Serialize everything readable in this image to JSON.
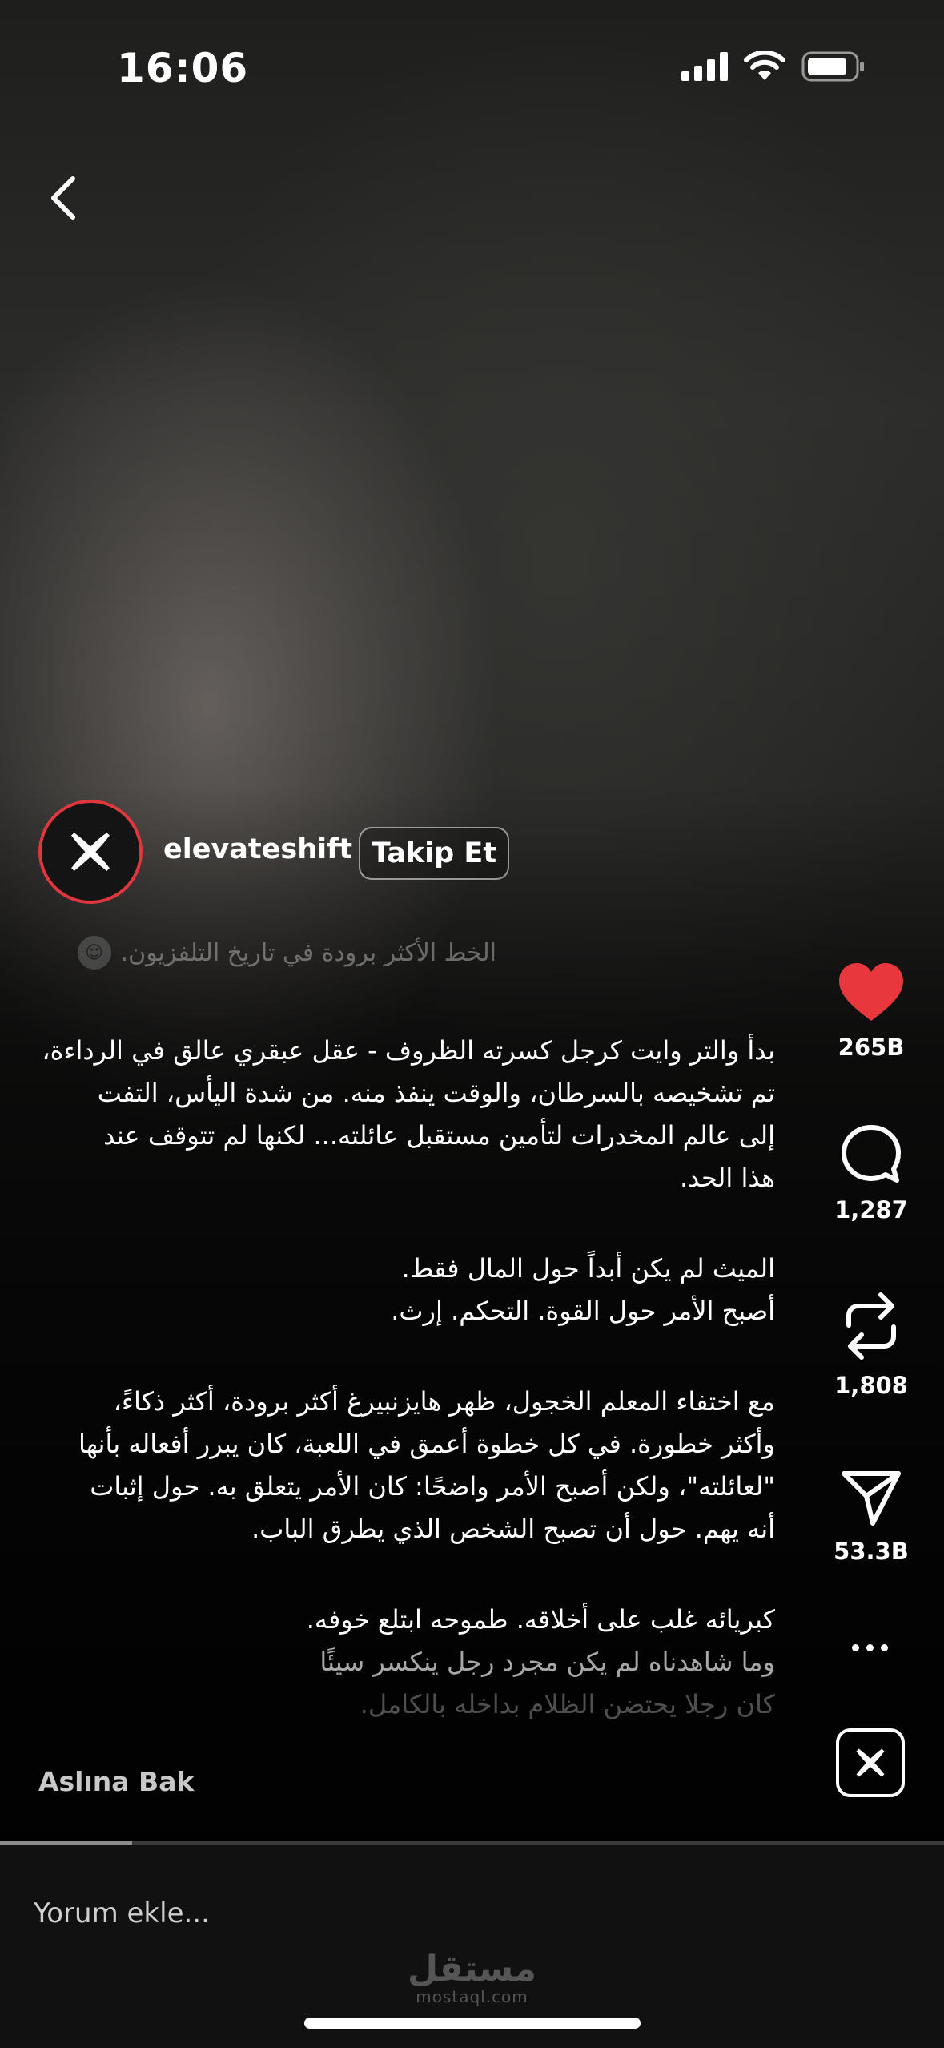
{
  "status_bar": {
    "time": "16:06"
  },
  "profile": {
    "username": "elevateshift",
    "follow_label": "Takip Et"
  },
  "caption": {
    "title": "الخط الأكثر برودة في تاريخ التلفزيون.",
    "paragraphs": [
      [
        "بدأ والتر وايت كرجل كسرته الظروف - عقل عبقري عالق في الرداءة،",
        "تم تشخيصه بالسرطان، والوقت ينفذ منه. من شدة اليأس، التفت",
        "إلى عالم المخدرات لتأمين مستقبل عائلته... لكنها لم تتوقف عند",
        "هذا الحد."
      ],
      [
        "الميث لم يكن أبداً حول المال فقط.",
        "أصبح الأمر حول القوة. التحكم. إرث."
      ],
      [
        "مع اختفاء المعلم الخجول، ظهر هايزنبيرغ أكثر برودة، أكثر ذكاءً،",
        "وأكثر خطورة. في كل خطوة أعمق في اللعبة، كان يبرر أفعاله بأنها",
        "\"لعائلته\"، ولكن أصبح الأمر واضحًا: كان الأمر يتعلق به. حول إثبات",
        "أنه يهم. حول أن تصبح الشخص الذي يطرق الباب."
      ],
      [
        "كبريائه غلب على أخلاقه. طموحه ابتلع خوفه.",
        "وما شاهدناه لم يكن مجرد رجل ينكسر سيئًا",
        "كان رجلا يحتضن الظلام بداخله بالكامل."
      ]
    ],
    "see_original": "Aslına Bak"
  },
  "actions": {
    "likes": "265B",
    "comments": "1,287",
    "reposts": "1,808",
    "shares": "53.3B",
    "like_color": "#e8383d"
  },
  "video_progress": 0.14,
  "comment_bar": {
    "placeholder": "Yorum ekle..."
  },
  "watermark": {
    "arabic": "مستقل",
    "latin": "mostaql.com"
  }
}
